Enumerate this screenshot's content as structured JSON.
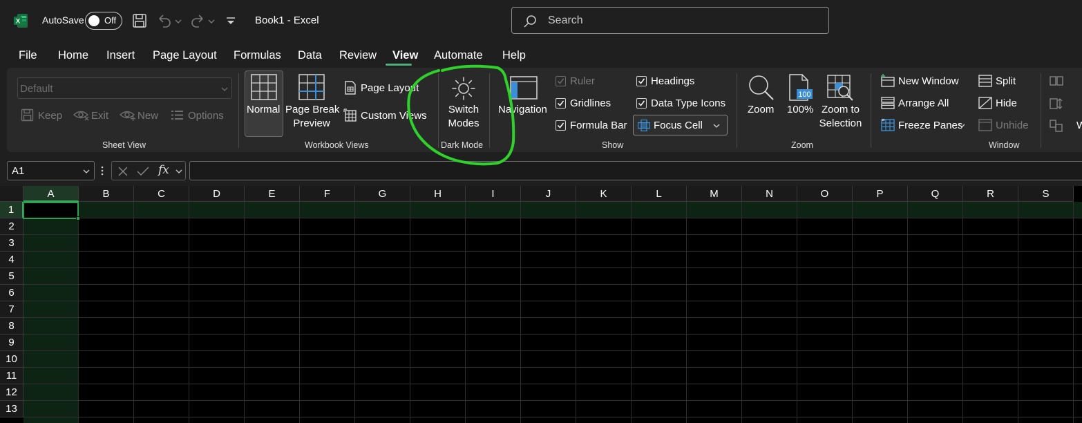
{
  "titlebar": {
    "autosave_label": "AutoSave",
    "autosave_state": "Off",
    "doc_title": "Book1  -  Excel",
    "search_placeholder": "Search"
  },
  "tabs": [
    "File",
    "Home",
    "Insert",
    "Page Layout",
    "Formulas",
    "Data",
    "Review",
    "View",
    "Automate",
    "Help"
  ],
  "active_tab": "View",
  "ribbon": {
    "sheet_view": {
      "dropdown_value": "Default",
      "keep": "Keep",
      "exit": "Exit",
      "new": "New",
      "options": "Options",
      "label": "Sheet View"
    },
    "workbook_views": {
      "normal": "Normal",
      "page_break_1": "Page Break",
      "page_break_2": "Preview",
      "page_layout": "Page Layout",
      "custom_views": "Custom Views",
      "label": "Workbook Views"
    },
    "dark_mode": {
      "switch_1": "Switch",
      "switch_2": "Modes",
      "label": "Dark Mode"
    },
    "show": {
      "navigation": "Navigation",
      "ruler": "Ruler",
      "gridlines": "Gridlines",
      "formula_bar": "Formula Bar",
      "headings": "Headings",
      "data_type_icons": "Data Type Icons",
      "focus_cell": "Focus Cell",
      "label": "Show"
    },
    "zoom": {
      "zoom": "Zoom",
      "hundred": "100%",
      "hundred_badge": "100",
      "zoom_to_1": "Zoom to",
      "zoom_to_2": "Selection",
      "label": "Zoom"
    },
    "window": {
      "new_window": "New Window",
      "arrange_all": "Arrange All",
      "freeze_panes": "Freeze Panes",
      "split": "Split",
      "hide": "Hide",
      "unhide": "Unhide",
      "label": "Window"
    }
  },
  "formula_bar": {
    "name_box": "A1",
    "fx": "fx",
    "value": ""
  },
  "grid": {
    "columns": [
      "A",
      "B",
      "C",
      "D",
      "E",
      "F",
      "G",
      "H",
      "I",
      "J",
      "K",
      "L",
      "M",
      "N",
      "O",
      "P",
      "Q",
      "R",
      "S"
    ],
    "rows": [
      "1",
      "2",
      "3",
      "4",
      "5",
      "6",
      "7",
      "8",
      "9",
      "10",
      "11",
      "12",
      "13"
    ],
    "selected_cell": "A1"
  },
  "colors": {
    "accent_green": "#2e9e52",
    "annotation_green": "#2fd12a",
    "background": "#1f1f1f",
    "ribbon": "#292929"
  }
}
